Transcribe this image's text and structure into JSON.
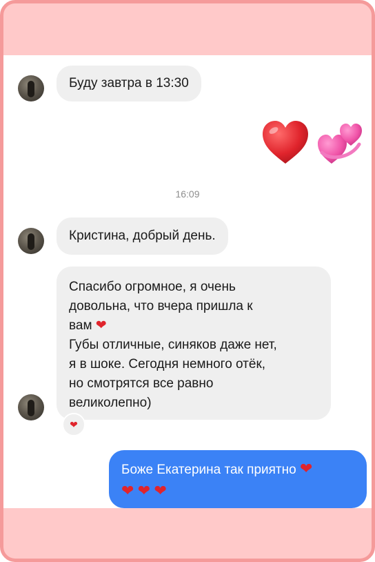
{
  "colors": {
    "frame_border": "#f59a9a",
    "frame_fill": "#ffc9c9",
    "incoming_bubble": "#efefef",
    "outgoing_bubble": "#3b82f6",
    "heart_red": "#e0242c",
    "two_hearts_pink": "#f054a8"
  },
  "messages": {
    "m1": {
      "text": "Буду завтра в 13:30"
    },
    "sticker_hearts": {
      "icons": [
        "red-heart-icon",
        "two-hearts-icon"
      ]
    },
    "timestamp": "16:09",
    "m2": {
      "text": "Кристина, добрый день."
    },
    "m3": {
      "lines": [
        "Спасибо огромное, я очень",
        "довольна, что вчера пришла к",
        "вам",
        "Губы отличные, синяков даже нет,",
        "я в шоке. Сегодня немного отёк,",
        "но смотрятся все равно",
        "великолепно)"
      ],
      "reaction_icon": "red-heart-icon"
    },
    "m4": {
      "line1": "Боже Екатерина так приятно",
      "trailing_hearts": 4
    }
  }
}
